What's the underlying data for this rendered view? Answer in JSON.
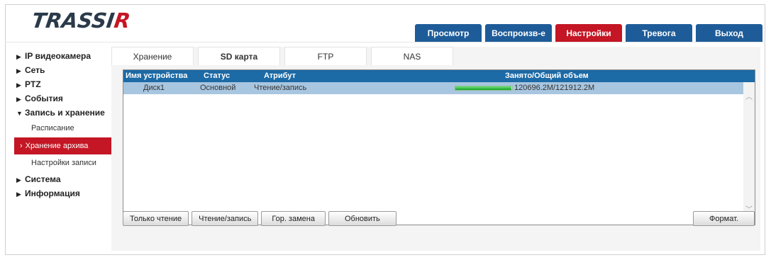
{
  "logo": {
    "text": "TRASSI",
    "r": "R"
  },
  "nav": [
    {
      "label": "Просмотр",
      "active": false
    },
    {
      "label": "Воспроизв-е",
      "active": false
    },
    {
      "label": "Настройки",
      "active": true
    },
    {
      "label": "Тревога",
      "active": false
    },
    {
      "label": "Выход",
      "active": false
    }
  ],
  "sidebar": {
    "items": [
      {
        "label": "IP видеокамера"
      },
      {
        "label": "Сеть"
      },
      {
        "label": "PTZ"
      },
      {
        "label": "События"
      },
      {
        "label": "Запись и хранение"
      }
    ],
    "subitems": [
      {
        "label": "Расписание"
      },
      {
        "label": "Хранение архива"
      },
      {
        "label": "Настройки записи"
      }
    ],
    "items2": [
      {
        "label": "Система"
      },
      {
        "label": "Информация"
      }
    ]
  },
  "tabs": [
    {
      "label": "Хранение"
    },
    {
      "label": "SD карта"
    },
    {
      "label": "FTP"
    },
    {
      "label": "NAS"
    }
  ],
  "table": {
    "headers": [
      "Имя устройства",
      "Статус",
      "Атрибут",
      "Занято/Общий объем"
    ],
    "rows": [
      {
        "name": "Диск1",
        "status": "Основной",
        "attribute": "Чтение/запись",
        "usage": "120696.2M/121912.2M",
        "usage_fraction": 0.99
      }
    ]
  },
  "buttons": {
    "read_only": "Только чтение",
    "read_write": "Чтение/запись",
    "hot_swap": "Гор. замена",
    "refresh": "Обновить",
    "format": "Формат."
  },
  "colors": {
    "primary": "#1e5c99",
    "accent": "#c41624",
    "row_selected": "#a8c6e0",
    "progress": "#1aa12a"
  }
}
